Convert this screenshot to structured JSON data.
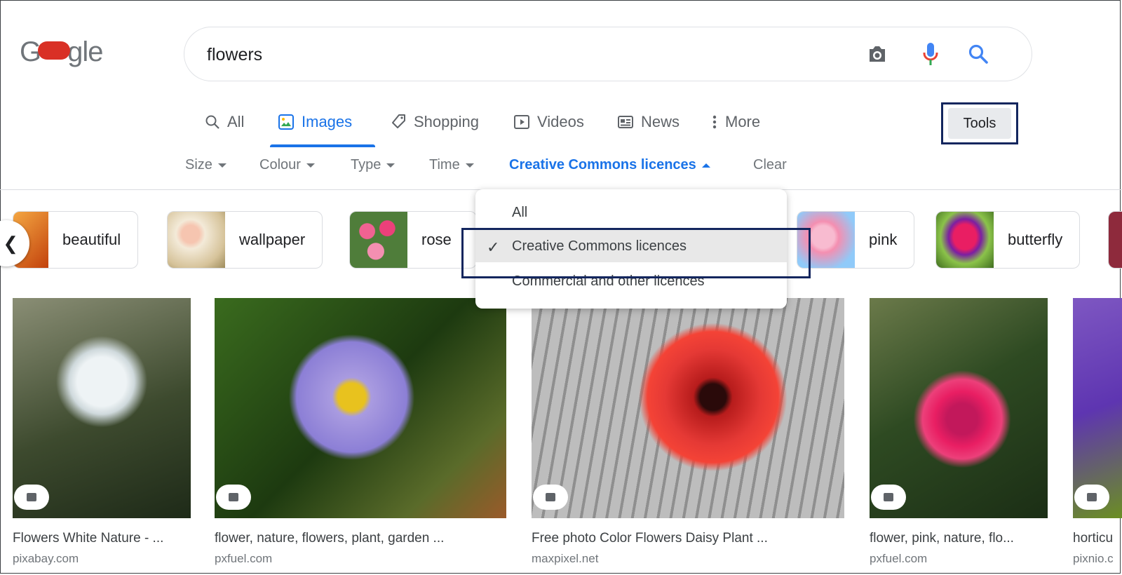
{
  "logo": {
    "text_left": "G",
    "text_right": "gle"
  },
  "search": {
    "query": "flowers"
  },
  "tabs": [
    {
      "label": "All",
      "icon": "search-icon"
    },
    {
      "label": "Images",
      "icon": "image-icon"
    },
    {
      "label": "Shopping",
      "icon": "tag-icon"
    },
    {
      "label": "Videos",
      "icon": "play-icon"
    },
    {
      "label": "News",
      "icon": "newspaper-icon"
    },
    {
      "label": "More",
      "icon": "dots-vertical-icon"
    }
  ],
  "active_tab": "Images",
  "tools_label": "Tools",
  "filters": [
    {
      "label": "Size"
    },
    {
      "label": "Colour"
    },
    {
      "label": "Type"
    },
    {
      "label": "Time"
    },
    {
      "label": "Creative Commons licences"
    }
  ],
  "clear_label": "Clear",
  "chips": [
    {
      "label": "beautiful"
    },
    {
      "label": "wallpaper"
    },
    {
      "label": "rose"
    },
    {
      "label": "pink"
    },
    {
      "label": "butterfly"
    }
  ],
  "dropdown": {
    "items": [
      {
        "label": "All"
      },
      {
        "label": "Creative Commons licences",
        "selected": true
      },
      {
        "label": "Commercial and other licences"
      }
    ],
    "check": "✓"
  },
  "results": [
    {
      "title": "Flowers White Nature - ...",
      "site": "pixabay.com"
    },
    {
      "title": "flower, nature, flowers, plant, garden ...",
      "site": "pxfuel.com"
    },
    {
      "title": "Free photo Color Flowers Daisy Plant ...",
      "site": "maxpixel.net"
    },
    {
      "title": "flower, pink, nature, flo...",
      "site": "pxfuel.com"
    },
    {
      "title": "horticu",
      "site": "pixnio.c"
    }
  ],
  "colors": {
    "accent": "#1a73e8",
    "highlight_border": "#13265e"
  }
}
